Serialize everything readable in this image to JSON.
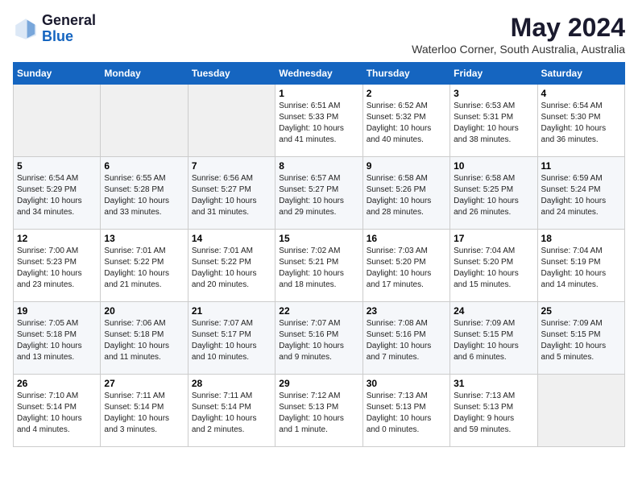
{
  "logo": {
    "general": "General",
    "blue": "Blue"
  },
  "header": {
    "month": "May 2024",
    "location": "Waterloo Corner, South Australia, Australia"
  },
  "days_of_week": [
    "Sunday",
    "Monday",
    "Tuesday",
    "Wednesday",
    "Thursday",
    "Friday",
    "Saturday"
  ],
  "weeks": [
    [
      {
        "day": "",
        "info": ""
      },
      {
        "day": "",
        "info": ""
      },
      {
        "day": "",
        "info": ""
      },
      {
        "day": "1",
        "info": "Sunrise: 6:51 AM\nSunset: 5:33 PM\nDaylight: 10 hours\nand 41 minutes."
      },
      {
        "day": "2",
        "info": "Sunrise: 6:52 AM\nSunset: 5:32 PM\nDaylight: 10 hours\nand 40 minutes."
      },
      {
        "day": "3",
        "info": "Sunrise: 6:53 AM\nSunset: 5:31 PM\nDaylight: 10 hours\nand 38 minutes."
      },
      {
        "day": "4",
        "info": "Sunrise: 6:54 AM\nSunset: 5:30 PM\nDaylight: 10 hours\nand 36 minutes."
      }
    ],
    [
      {
        "day": "5",
        "info": "Sunrise: 6:54 AM\nSunset: 5:29 PM\nDaylight: 10 hours\nand 34 minutes."
      },
      {
        "day": "6",
        "info": "Sunrise: 6:55 AM\nSunset: 5:28 PM\nDaylight: 10 hours\nand 33 minutes."
      },
      {
        "day": "7",
        "info": "Sunrise: 6:56 AM\nSunset: 5:27 PM\nDaylight: 10 hours\nand 31 minutes."
      },
      {
        "day": "8",
        "info": "Sunrise: 6:57 AM\nSunset: 5:27 PM\nDaylight: 10 hours\nand 29 minutes."
      },
      {
        "day": "9",
        "info": "Sunrise: 6:58 AM\nSunset: 5:26 PM\nDaylight: 10 hours\nand 28 minutes."
      },
      {
        "day": "10",
        "info": "Sunrise: 6:58 AM\nSunset: 5:25 PM\nDaylight: 10 hours\nand 26 minutes."
      },
      {
        "day": "11",
        "info": "Sunrise: 6:59 AM\nSunset: 5:24 PM\nDaylight: 10 hours\nand 24 minutes."
      }
    ],
    [
      {
        "day": "12",
        "info": "Sunrise: 7:00 AM\nSunset: 5:23 PM\nDaylight: 10 hours\nand 23 minutes."
      },
      {
        "day": "13",
        "info": "Sunrise: 7:01 AM\nSunset: 5:22 PM\nDaylight: 10 hours\nand 21 minutes."
      },
      {
        "day": "14",
        "info": "Sunrise: 7:01 AM\nSunset: 5:22 PM\nDaylight: 10 hours\nand 20 minutes."
      },
      {
        "day": "15",
        "info": "Sunrise: 7:02 AM\nSunset: 5:21 PM\nDaylight: 10 hours\nand 18 minutes."
      },
      {
        "day": "16",
        "info": "Sunrise: 7:03 AM\nSunset: 5:20 PM\nDaylight: 10 hours\nand 17 minutes."
      },
      {
        "day": "17",
        "info": "Sunrise: 7:04 AM\nSunset: 5:20 PM\nDaylight: 10 hours\nand 15 minutes."
      },
      {
        "day": "18",
        "info": "Sunrise: 7:04 AM\nSunset: 5:19 PM\nDaylight: 10 hours\nand 14 minutes."
      }
    ],
    [
      {
        "day": "19",
        "info": "Sunrise: 7:05 AM\nSunset: 5:18 PM\nDaylight: 10 hours\nand 13 minutes."
      },
      {
        "day": "20",
        "info": "Sunrise: 7:06 AM\nSunset: 5:18 PM\nDaylight: 10 hours\nand 11 minutes."
      },
      {
        "day": "21",
        "info": "Sunrise: 7:07 AM\nSunset: 5:17 PM\nDaylight: 10 hours\nand 10 minutes."
      },
      {
        "day": "22",
        "info": "Sunrise: 7:07 AM\nSunset: 5:16 PM\nDaylight: 10 hours\nand 9 minutes."
      },
      {
        "day": "23",
        "info": "Sunrise: 7:08 AM\nSunset: 5:16 PM\nDaylight: 10 hours\nand 7 minutes."
      },
      {
        "day": "24",
        "info": "Sunrise: 7:09 AM\nSunset: 5:15 PM\nDaylight: 10 hours\nand 6 minutes."
      },
      {
        "day": "25",
        "info": "Sunrise: 7:09 AM\nSunset: 5:15 PM\nDaylight: 10 hours\nand 5 minutes."
      }
    ],
    [
      {
        "day": "26",
        "info": "Sunrise: 7:10 AM\nSunset: 5:14 PM\nDaylight: 10 hours\nand 4 minutes."
      },
      {
        "day": "27",
        "info": "Sunrise: 7:11 AM\nSunset: 5:14 PM\nDaylight: 10 hours\nand 3 minutes."
      },
      {
        "day": "28",
        "info": "Sunrise: 7:11 AM\nSunset: 5:14 PM\nDaylight: 10 hours\nand 2 minutes."
      },
      {
        "day": "29",
        "info": "Sunrise: 7:12 AM\nSunset: 5:13 PM\nDaylight: 10 hours\nand 1 minute."
      },
      {
        "day": "30",
        "info": "Sunrise: 7:13 AM\nSunset: 5:13 PM\nDaylight: 10 hours\nand 0 minutes."
      },
      {
        "day": "31",
        "info": "Sunrise: 7:13 AM\nSunset: 5:13 PM\nDaylight: 9 hours\nand 59 minutes."
      },
      {
        "day": "",
        "info": ""
      }
    ]
  ]
}
